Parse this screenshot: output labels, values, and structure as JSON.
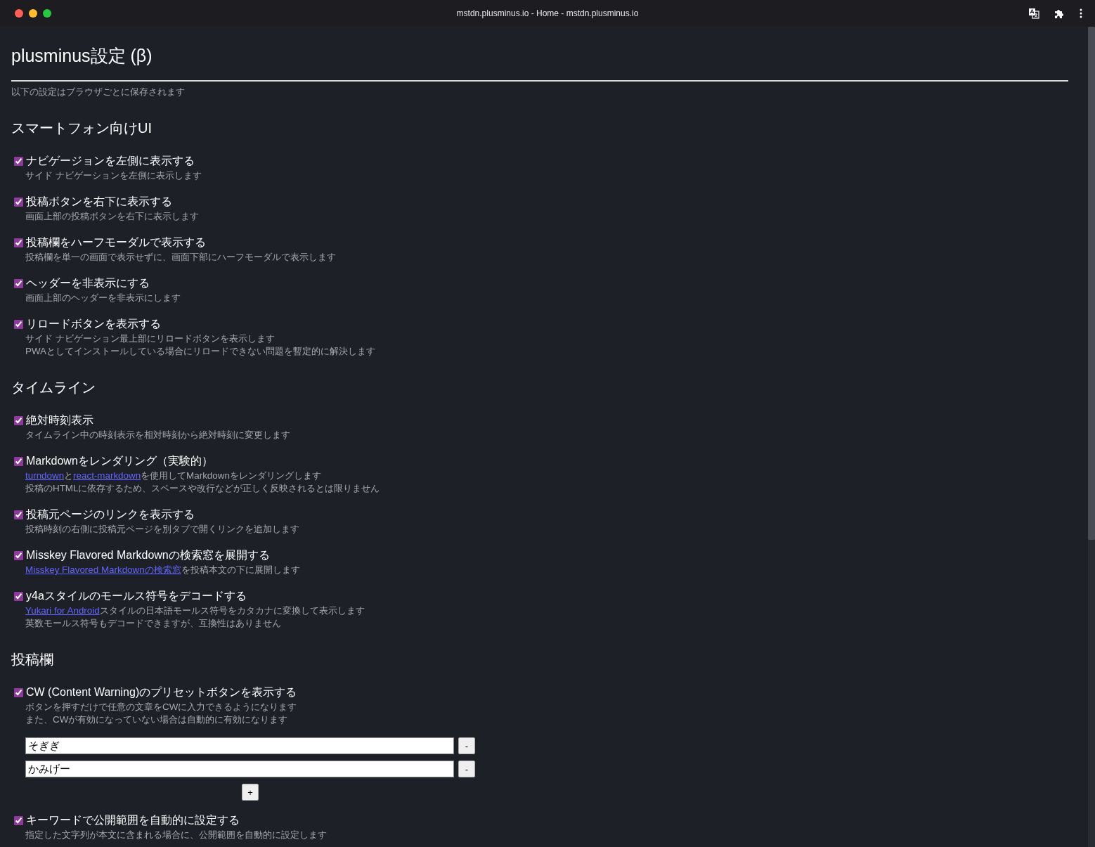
{
  "window": {
    "title": "mstdn.plusminus.io - Home - mstdn.plusminus.io"
  },
  "page": {
    "title": "plusminus設定 (β)",
    "note": "以下の設定はブラウザごとに保存されます"
  },
  "sections": [
    {
      "heading": "スマートフォン向けUI",
      "settings": [
        {
          "label": "ナビゲージョンを左側に表示する",
          "checked": true,
          "description": [
            [
              {
                "text": "サイド ナビゲーションを左側に表示します",
                "link": false
              }
            ]
          ]
        },
        {
          "label": "投稿ボタンを右下に表示する",
          "checked": true,
          "description": [
            [
              {
                "text": "画面上部の投稿ボタンを右下に表示します",
                "link": false
              }
            ]
          ]
        },
        {
          "label": "投稿欄をハーフモーダルで表示する",
          "checked": true,
          "description": [
            [
              {
                "text": "投稿欄を単一の画面で表示せずに、画面下部にハーフモーダルで表示します",
                "link": false
              }
            ]
          ]
        },
        {
          "label": "ヘッダーを非表示にする",
          "checked": true,
          "description": [
            [
              {
                "text": "画面上部のヘッダーを非表示にします",
                "link": false
              }
            ]
          ]
        },
        {
          "label": "リロードボタンを表示する",
          "checked": true,
          "description": [
            [
              {
                "text": "サイド ナビゲーション最上部にリロードボタンを表示します",
                "link": false
              }
            ],
            [
              {
                "text": "PWAとしてインストールしている場合にリロードできない問題を暫定的に解決します",
                "link": false
              }
            ]
          ]
        }
      ]
    },
    {
      "heading": "タイムライン",
      "settings": [
        {
          "label": "絶対時刻表示",
          "checked": true,
          "description": [
            [
              {
                "text": "タイムライン中の時刻表示を相対時刻から絶対時刻に変更します",
                "link": false
              }
            ]
          ]
        },
        {
          "label": "Markdownをレンダリング（実験的）",
          "checked": true,
          "description": [
            [
              {
                "text": "turndown",
                "link": true
              },
              {
                "text": "と",
                "link": false
              },
              {
                "text": "react-markdown",
                "link": true
              },
              {
                "text": "を使用してMarkdownをレンダリングします",
                "link": false
              }
            ],
            [
              {
                "text": "投稿のHTMLに依存するため、スペースや改行などが正しく反映されるとは限りません",
                "link": false
              }
            ]
          ]
        },
        {
          "label": "投稿元ページのリンクを表示する",
          "checked": true,
          "description": [
            [
              {
                "text": "投稿時刻の右側に投稿元ページを別タブで開くリンクを追加します",
                "link": false
              }
            ]
          ]
        },
        {
          "label": "Misskey Flavored Markdownの検索窓を展開する",
          "checked": true,
          "description": [
            [
              {
                "text": "Misskey Flavored Markdownの検索窓",
                "link": true
              },
              {
                "text": "を投稿本文の下に展開します",
                "link": false
              }
            ]
          ]
        },
        {
          "label": "y4aスタイルのモールス符号をデコードする",
          "checked": true,
          "description": [
            [
              {
                "text": "Yukari for Android",
                "link": true
              },
              {
                "text": "スタイルの日本語モールス符号をカタカナに変換して表示します",
                "link": false
              }
            ],
            [
              {
                "text": "英数モールス符号もデコードできますが、互換性はありません",
                "link": false
              }
            ]
          ]
        }
      ]
    },
    {
      "heading": "投稿欄",
      "settings": [
        {
          "label": "CW (Content Warning)のプリセットボタンを表示する",
          "checked": true,
          "description": [
            [
              {
                "text": "ボタンを押すだけで任意の文章をCWに入力できるようになります",
                "link": false
              }
            ],
            [
              {
                "text": "また、CWが有効になっていない場合は自動的に有効になります",
                "link": false
              }
            ]
          ],
          "presets": [
            {
              "value": "そぎぎ",
              "remove_button": "-"
            },
            {
              "value": "かみげー",
              "remove_button": "-"
            }
          ],
          "add_button": "+"
        },
        {
          "label": "キーワードで公開範囲を自動的に設定する",
          "checked": true,
          "description": [
            [
              {
                "text": "指定した文字列が本文に含まれる場合に、公開範囲を自動的に設定します",
                "link": false
              }
            ]
          ]
        }
      ]
    }
  ]
}
